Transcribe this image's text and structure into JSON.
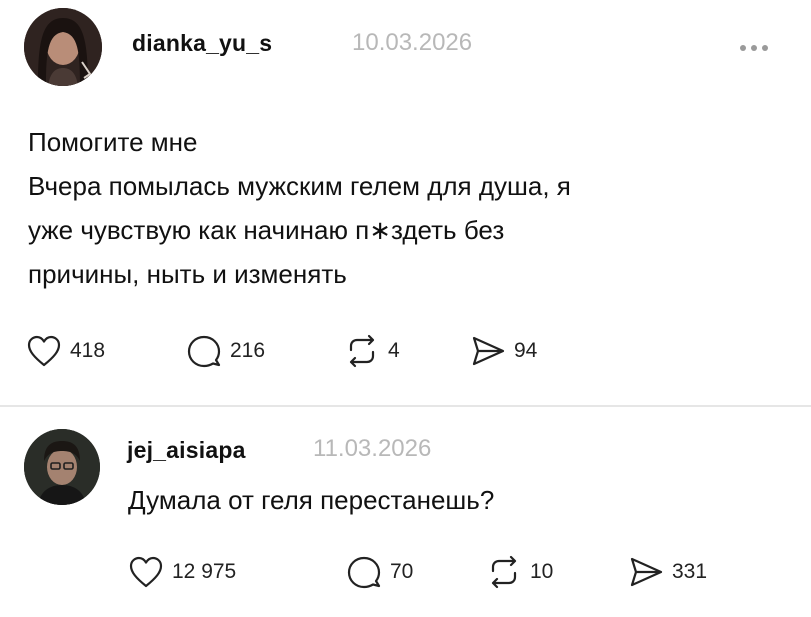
{
  "posts": [
    {
      "username": "dianka_yu_s",
      "date": "10.03.2026",
      "lines": [
        "Помогите мне",
        "Вчера помылась мужским гелем для душа, я",
        "уже чувствую как начинаю п∗здеть без",
        "причины, ныть и изменять"
      ],
      "stats": {
        "likes": "418",
        "comments": "216",
        "reposts": "4",
        "shares": "94"
      }
    },
    {
      "username": "jej_aisiapa",
      "date": "11.03.2026",
      "text": "Думала от геля перестанешь?",
      "stats": {
        "likes": "12 975",
        "comments": "70",
        "reposts": "10",
        "shares": "331"
      }
    }
  ],
  "icons": {
    "like": "heart-icon",
    "comment": "speech-bubble-icon",
    "repost": "repost-icon",
    "share": "send-icon",
    "more": "more-icon"
  }
}
